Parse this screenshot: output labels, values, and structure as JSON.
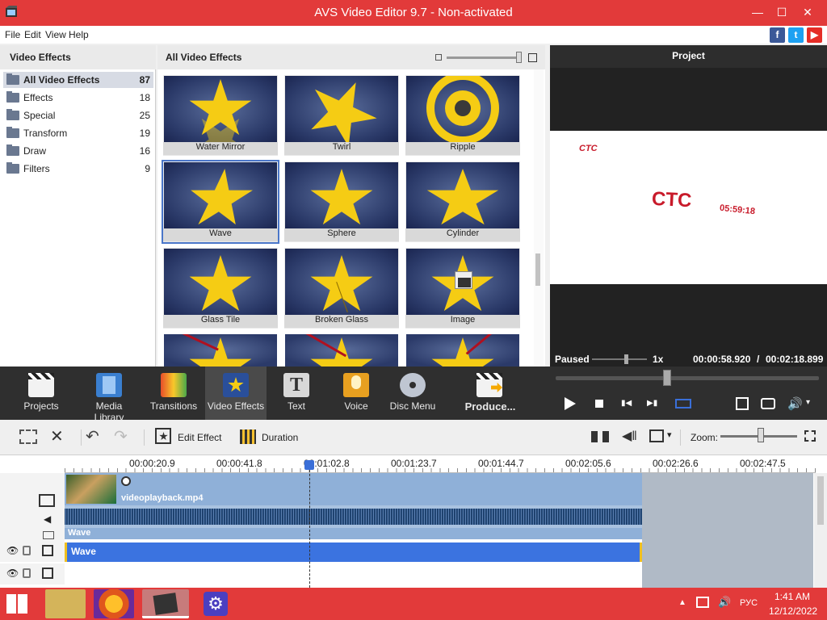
{
  "window": {
    "title": "AVS Video Editor 9.7 - Non-activated",
    "minimize": "—",
    "maximize": "☐",
    "close": "✕"
  },
  "menu": {
    "file": "File",
    "edit": "Edit",
    "view": "View",
    "help": "Help"
  },
  "social": {
    "facebook": "f",
    "twitter": "t",
    "youtube": "▶"
  },
  "left_panel": {
    "title": "Video Effects",
    "categories": [
      {
        "label": "All Video Effects",
        "count": "87"
      },
      {
        "label": "Effects",
        "count": "18"
      },
      {
        "label": "Special",
        "count": "25"
      },
      {
        "label": "Transform",
        "count": "19"
      },
      {
        "label": "Draw",
        "count": "16"
      },
      {
        "label": "Filters",
        "count": "9"
      }
    ]
  },
  "gallery": {
    "title": "All Video Effects",
    "tiles": [
      "Water Mirror",
      "Twirl",
      "Ripple",
      "Wave",
      "Sphere",
      "Cylinder",
      "Glass Tile",
      "Broken Glass",
      "Image"
    ]
  },
  "preview": {
    "title": "Project",
    "overlay_small": "CTC",
    "overlay_logo": "CTC",
    "overlay_time": "05:59:18",
    "state": "Paused",
    "speed": "1x",
    "current": "00:00:58.920",
    "sep": "/",
    "total": "00:02:18.899"
  },
  "toolbar": {
    "projects": "Projects",
    "media_library": "Media Library",
    "transitions": "Transitions",
    "video_effects": "Video Effects",
    "text": "Text",
    "voice": "Voice",
    "disc_menu": "Disc Menu",
    "produce": "Produce..."
  },
  "editbar": {
    "edit_effect": "Edit Effect",
    "duration": "Duration",
    "zoom": "Zoom:"
  },
  "timeline": {
    "ticks": [
      "00:00:20.9",
      "00:00:41.8",
      "00:01:02.8",
      "00:01:23.7",
      "00:01:44.7",
      "00:02:05.6",
      "00:02:26.6",
      "00:02:47.5"
    ],
    "clip_name": "videoplayback.mp4",
    "effect_on_clip": "Wave",
    "effect_track": "Wave"
  },
  "taskbar": {
    "lang": "РУС",
    "time": "1:41 AM",
    "date": "12/12/2022"
  },
  "colors": {
    "title_red": "#e23a3a",
    "accent_blue": "#3a6fd8",
    "dark": "#2f2f2f"
  }
}
